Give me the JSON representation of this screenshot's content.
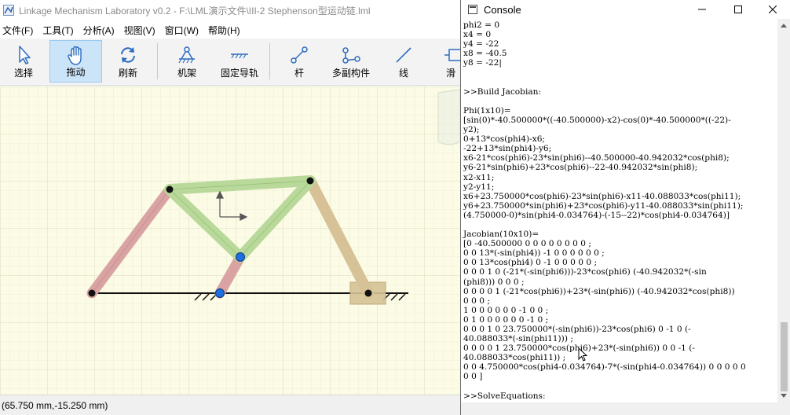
{
  "app": {
    "title": "Linkage Mechanism Laboratory v0.2 - F:\\LML演示文件\\III-2 Stephenson型运动链.lml",
    "menu": [
      "文件(F)",
      "工具(T)",
      "分析(A)",
      "视图(V)",
      "窗口(W)",
      "帮助(H)"
    ],
    "toolbar": {
      "select": "选择",
      "drag": "拖动",
      "refresh": "刷新",
      "frame": "机架",
      "fixed_rail": "固定导轨",
      "bar": "杆",
      "multi_pair": "多副构件",
      "line": "线",
      "slider": "滑"
    },
    "active_tool": "drag",
    "status_coords": "(65.750 mm,-15.250 mm)"
  },
  "colors": {
    "grid_bg": "#fbfbe6",
    "grid_line": "#e3e3c4",
    "link_red": "#d9a3a3",
    "link_green": "#b9d99b",
    "link_tan": "#d6c296",
    "toolbar_active": "#cce4f7"
  },
  "console": {
    "title": "Console",
    "lines": [
      "phi2 = 0",
      "x4 = 0",
      "y4 = -22",
      "x8 = -40.5",
      "y8 = -22|",
      "",
      "",
      ">>Build Jacobian:",
      "",
      "Phi(1x10)=",
      "[sin(0)*-40.500000*((-40.500000)-x2)-cos(0)*-40.500000*((-22)-",
      "y2);",
      "0+13*cos(phi4)-x6;",
      "-22+13*sin(phi4)-y6;",
      "x6-21*cos(phi6)-23*sin(phi6)--40.500000-40.942032*cos(phi8);",
      "y6-21*sin(phi6)+23*cos(phi6)--22-40.942032*sin(phi8);",
      "x2-x11;",
      "y2-y11;",
      "x6+23.750000*cos(phi6)-23*sin(phi6)-x11-40.088033*cos(phi11);",
      "y6+23.750000*sin(phi6)+23*cos(phi6)-y11-40.088033*sin(phi11);",
      "(4.750000-0)*sin(phi4-0.034764)-(-15--22)*cos(phi4-0.034764)]",
      "",
      "Jacobian(10x10)=",
      "[0 -40.500000 0 0 0 0 0 0 0 0 ;",
      "0 0 13*(-sin(phi4)) -1 0 0 0 0 0 0 ;",
      "0 0 13*cos(phi4) 0 -1 0 0 0 0 0 ;",
      "0 0 0 1 0 (-21*(-sin(phi6)))-23*cos(phi6) (-40.942032*(-sin",
      "(phi8))) 0 0 0 ;",
      "0 0 0 0 1 (-21*cos(phi6))+23*(-sin(phi6)) (-40.942032*cos(phi8))",
      "0 0 0 ;",
      "1 0 0 0 0 0 0 -1 0 0 ;",
      "0 1 0 0 0 0 0 0 -1 0 ;",
      "0 0 0 1 0 23.750000*(-sin(phi6))-23*cos(phi6) 0 -1 0 (-",
      "40.088033*(-sin(phi11))) ;",
      "0 0 0 0 1 23.750000*cos(phi6)+23*(-sin(phi6)) 0 0 -1 (-",
      "40.088033*cos(phi11)) ;",
      "0 0 4.750000*cos(phi4-0.034764)-7*(-sin(phi4-0.034764)) 0 0 0 0 0",
      "0 0 ]",
      "",
      ">>SolveEquations:"
    ]
  }
}
